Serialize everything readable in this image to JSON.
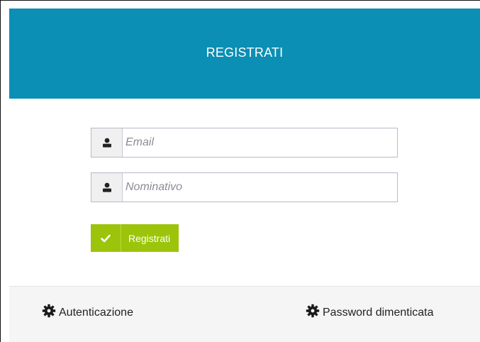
{
  "header": {
    "title": "REGISTRATI"
  },
  "form": {
    "email": {
      "placeholder": "Email",
      "icon": "user-icon"
    },
    "name": {
      "placeholder": "Nominativo",
      "icon": "user-icon"
    },
    "submit": {
      "label": "Registrati",
      "icon": "check-icon"
    }
  },
  "footer": {
    "links": [
      {
        "label": "Autenticazione",
        "icon": "gear-icon"
      },
      {
        "label": "Password dimenticata",
        "icon": "gear-icon"
      }
    ]
  },
  "colors": {
    "header_bg": "#0b8fb4",
    "button_bg": "#9cc40a",
    "footer_bg": "#f5f5f5"
  }
}
